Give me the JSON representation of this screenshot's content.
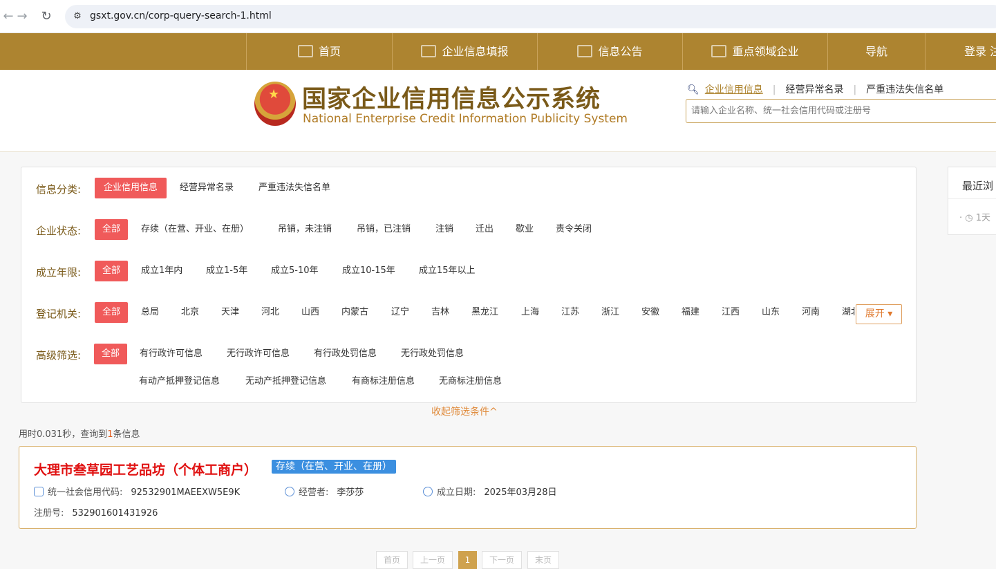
{
  "browser": {
    "url": "gsxt.gov.cn/corp-query-search-1.html",
    "back_icon": "arrow-left-icon",
    "forward_icon": "arrow-right-icon",
    "reload_icon": "reload-icon"
  },
  "topnav": {
    "items": [
      {
        "label": "首页",
        "icon": "monitor-icon"
      },
      {
        "label": "企业信息填报",
        "icon": "pen-icon"
      },
      {
        "label": "信息公告",
        "icon": "document-icon"
      },
      {
        "label": "重点领域企业",
        "icon": "speaker-icon"
      },
      {
        "label": "导航"
      },
      {
        "label": "登录 注"
      }
    ]
  },
  "header": {
    "title": "国家企业信用信息公示系统",
    "subtitle": "National Enterprise Credit Information Publicity System",
    "search_tabs": [
      "企业信用信息",
      "经营异常名录",
      "严重违法失信名单"
    ],
    "search_placeholder": "请输入企业名称、统一社会信用代码或注册号"
  },
  "filters": {
    "category": {
      "label": "信息分类:",
      "options": [
        "企业信用信息",
        "经营异常名录",
        "严重违法失信名单"
      ],
      "selected": "企业信用信息"
    },
    "status": {
      "label": "企业状态:",
      "options": [
        "全部",
        "存续（在营、开业、在册）",
        "吊销，未注销",
        "吊销，已注销",
        "注销",
        "迁出",
        "歇业",
        "责令关闭"
      ],
      "selected": "全部"
    },
    "years": {
      "label": "成立年限:",
      "options": [
        "全部",
        "成立1年内",
        "成立1-5年",
        "成立5-10年",
        "成立10-15年",
        "成立15年以上"
      ],
      "selected": "全部"
    },
    "authority": {
      "label": "登记机关:",
      "options": [
        "全部",
        "总局",
        "北京",
        "天津",
        "河北",
        "山西",
        "内蒙古",
        "辽宁",
        "吉林",
        "黑龙江",
        "上海",
        "江苏",
        "浙江",
        "安徽",
        "福建",
        "江西",
        "山东",
        "河南",
        "湖北"
      ],
      "selected": "全部",
      "expand_label": "展开"
    },
    "advanced": {
      "label": "高级筛选:",
      "options": [
        "全部",
        "有行政许可信息",
        "无行政许可信息",
        "有行政处罚信息",
        "无行政处罚信息",
        "有动产抵押登记信息",
        "无动产抵押登记信息",
        "有商标注册信息",
        "无商标注册信息"
      ],
      "selected": "全部"
    },
    "collapse_label": "收起筛选条件^"
  },
  "stats": {
    "prefix": "用时0.031秒，查询到",
    "count": "1",
    "suffix": "条信息"
  },
  "result": {
    "name": "大理市叁草园工艺品坊（个体工商户）",
    "status": "存续（在营、开业、在册）",
    "credit_code_label": "统一社会信用代码:",
    "credit_code": "92532901MAEEXW5E9K",
    "operator_label": "经营者:",
    "operator": "李莎莎",
    "date_label": "成立日期:",
    "date": "2025年03月28日",
    "reg_label": "注册号:",
    "reg_no": "532901601431926"
  },
  "pager": {
    "first": "首页",
    "prev": "上一页",
    "current": "1",
    "next": "下一页",
    "last": "末页"
  },
  "recent": {
    "title": "最近浏",
    "item": "1天"
  },
  "colors": {
    "nav_gold": "#ad8430",
    "selected_red": "#f05a5a",
    "name_red": "#e01010",
    "status_blue": "#3b8fe0"
  }
}
